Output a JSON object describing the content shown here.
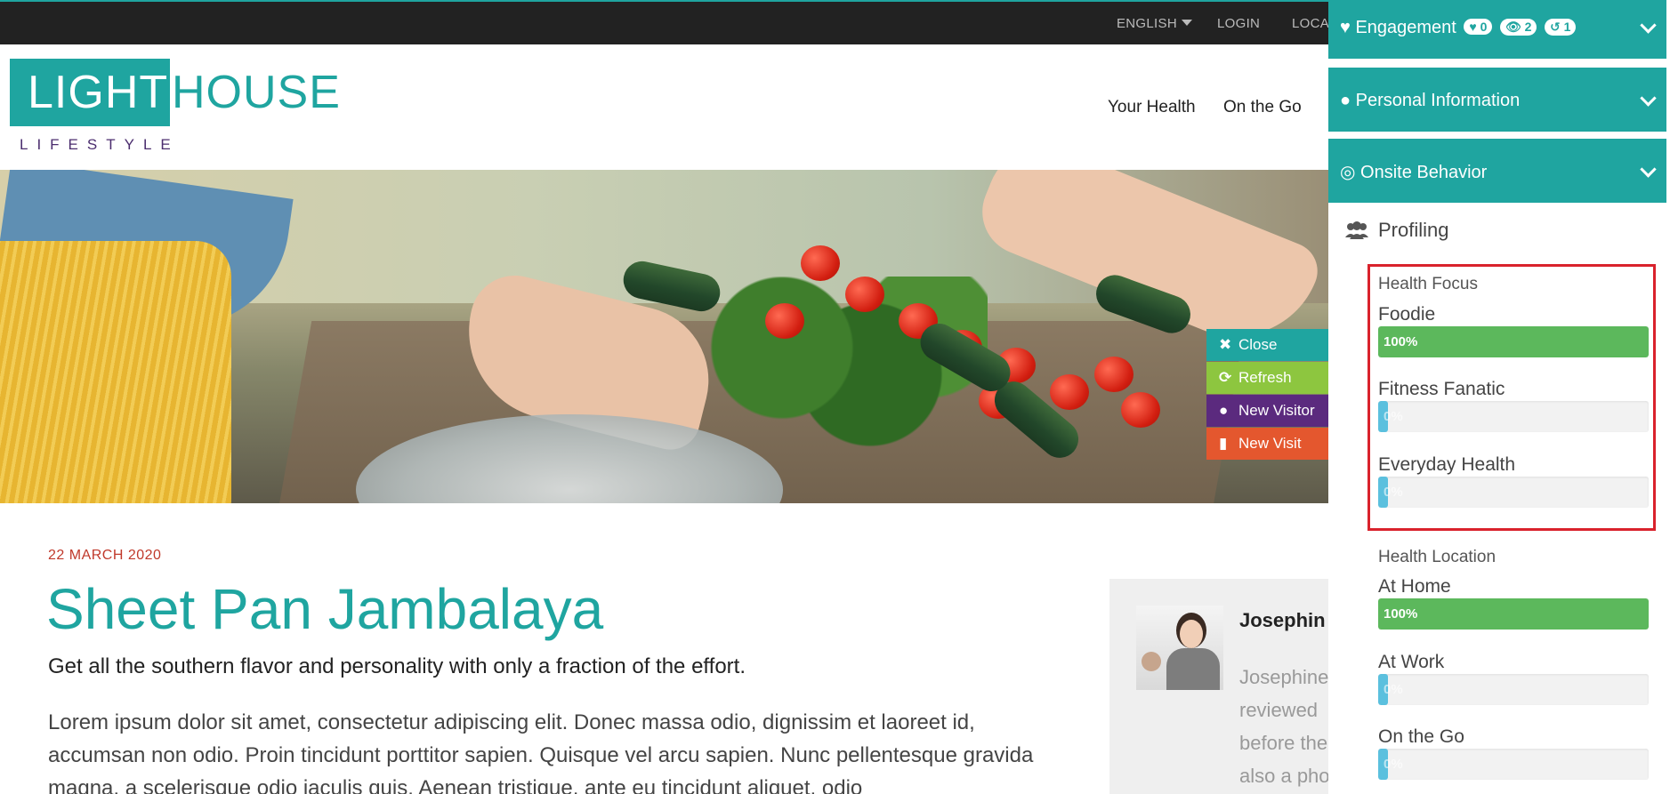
{
  "topbar": {
    "language": "ENGLISH",
    "login": "LOGIN",
    "locations": "LOCA"
  },
  "logo": {
    "light": "LIGHT",
    "house": "HOUSE",
    "tagline": "LIFESTYLE"
  },
  "nav": {
    "items": [
      "Your Health",
      "On the Go"
    ]
  },
  "visitor_actions": [
    {
      "label": "Close",
      "icon": "close-icon",
      "color": "#1fa5a0"
    },
    {
      "label": "Refresh",
      "icon": "refresh-icon",
      "color": "#8dc63f"
    },
    {
      "label": "New Visitor",
      "icon": "user-icon",
      "color": "#5b2a7e"
    },
    {
      "label": "New Visit",
      "icon": "document-icon",
      "color": "#e4572e"
    }
  ],
  "article": {
    "date": "22 MARCH 2020",
    "title": "Sheet Pan Jambalaya",
    "subtitle": "Get all the southern flavor and personality with only a fraction of the effort.",
    "body": "Lorem ipsum dolor sit amet, consectetur adipiscing elit. Donec massa odio, dignissim et laoreet id, accumsan non odio. Proin tincidunt porttitor sapien. Quisque vel arcu sapien. Nunc pellentesque gravida magna, a scelerisque odio iaculis quis. Aenean tristique, ante eu tincidunt aliquet, odio"
  },
  "author": {
    "name": "Josephin",
    "bio_lines": [
      "Josephine",
      "reviewed",
      "before the",
      "also a pho"
    ]
  },
  "panel": {
    "engagement": {
      "label": "Engagement",
      "likes": "0",
      "views": "2",
      "visits": "1"
    },
    "personal_information": {
      "label": "Personal Information"
    },
    "onsite_behavior": {
      "label": "Onsite Behavior"
    },
    "profiling": {
      "label": "Profiling"
    },
    "health_focus": {
      "title": "Health Focus",
      "items": [
        {
          "label": "Foodie",
          "value": 1.0,
          "text": "100%"
        },
        {
          "label": "Fitness Fanatic",
          "value": 0.0,
          "text": "0%"
        },
        {
          "label": "Everyday Health",
          "value": 0.0,
          "text": "0%"
        }
      ]
    },
    "health_location": {
      "title": "Health Location",
      "items": [
        {
          "label": "At Home",
          "value": 1.0,
          "text": "100%"
        },
        {
          "label": "At Work",
          "value": 0.0,
          "text": "0%"
        },
        {
          "label": "On the Go",
          "value": 0.0,
          "text": "0%"
        }
      ]
    },
    "colors": {
      "accent": "#1fa5a0",
      "success": "#5cb85c",
      "info": "#5bc0de",
      "highlight": "#d9222c"
    }
  }
}
